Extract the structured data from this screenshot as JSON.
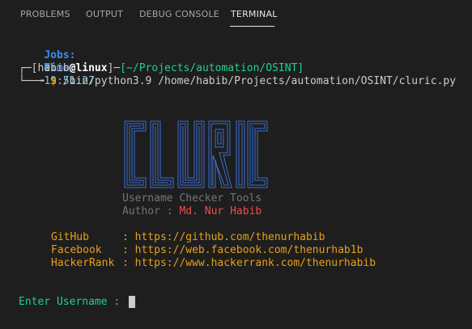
{
  "tabs": [
    {
      "label": "PROBLEMS",
      "active": false
    },
    {
      "label": "OUTPUT",
      "active": false
    },
    {
      "label": "DEBUG CONSOLE",
      "active": false
    },
    {
      "label": "TERMINAL",
      "active": true
    }
  ],
  "terminal": {
    "jobs_label": "Jobs:",
    "jobs_value": "0",
    "time_label": "Time:",
    "time_value": "19:51:27",
    "prompt": {
      "corner_top": "┌─",
      "bracket_open": "[",
      "user": "habib",
      "at": "@",
      "host": "linux",
      "bracket_close": "]",
      "dash": "─",
      "cwd": "[~/Projects/automation/OSINT]",
      "corner_bottom": "└──╼",
      "symbol": "$",
      "command": "/bin/python3.9 /home/habib/Projects/automation/OSINT/cluric.py"
    },
    "banner": {
      "logo_text": "CLURIC",
      "subtitle": "Username Checker Tools",
      "author_label": "Author :",
      "author_name": "Md. Nur Habib"
    },
    "links": [
      {
        "name": "GitHub",
        "sep": ":",
        "url": "https://github.com/thenurhabib"
      },
      {
        "name": "Facebook",
        "sep": ":",
        "url": "https://web.facebook.com/thenurhab1b"
      },
      {
        "name": "HackerRank",
        "sep": ":",
        "url": "https://www.hackerrank.com/thenurhabib"
      }
    ],
    "input_prompt": "Enter Username :"
  },
  "colors": {
    "background": "#1e1e1e",
    "tab_inactive": "#a6a6a6",
    "tab_active": "#e7e7e7",
    "label_blue": "#3b8eea",
    "value_cyan": "#6ec6e8",
    "text": "#cccccc",
    "host_white": "#ffffff",
    "path_green": "#23d18b",
    "logo_blue": "#3b6fd6",
    "gray": "#767676",
    "author_red": "#f14c4c",
    "link_orange": "#e5a01c",
    "prompt_green": "#23d18b"
  }
}
